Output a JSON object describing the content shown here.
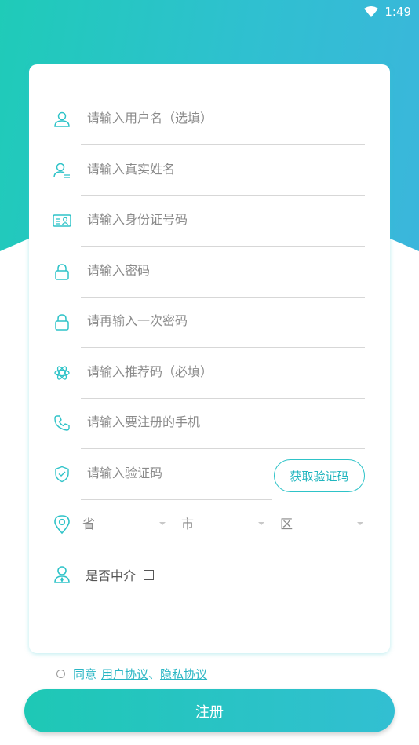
{
  "status_bar": {
    "time": "1:49"
  },
  "form": {
    "username_placeholder": "请输入用户名（选填）",
    "realname_placeholder": "请输入真实姓名",
    "idcard_placeholder": "请输入身份证号码",
    "password_placeholder": "请输入密码",
    "password_confirm_placeholder": "请再输入一次密码",
    "referral_placeholder": "请输入推荐码（必填）",
    "phone_placeholder": "请输入要注册的手机",
    "code_placeholder": "请输入验证码",
    "get_code_label": "获取验证码",
    "province_label": "省",
    "city_label": "市",
    "district_label": "区",
    "agent_label": "是否中介"
  },
  "agreement": {
    "agree_text": "同意",
    "user_agreement": "用户协议",
    "separator": "、",
    "privacy_agreement": "隐私协议"
  },
  "register_label": "注册",
  "colors": {
    "accent": "#2ec3c8",
    "gradient_start": "#1fcbb8",
    "gradient_end": "#3bb6dc"
  }
}
